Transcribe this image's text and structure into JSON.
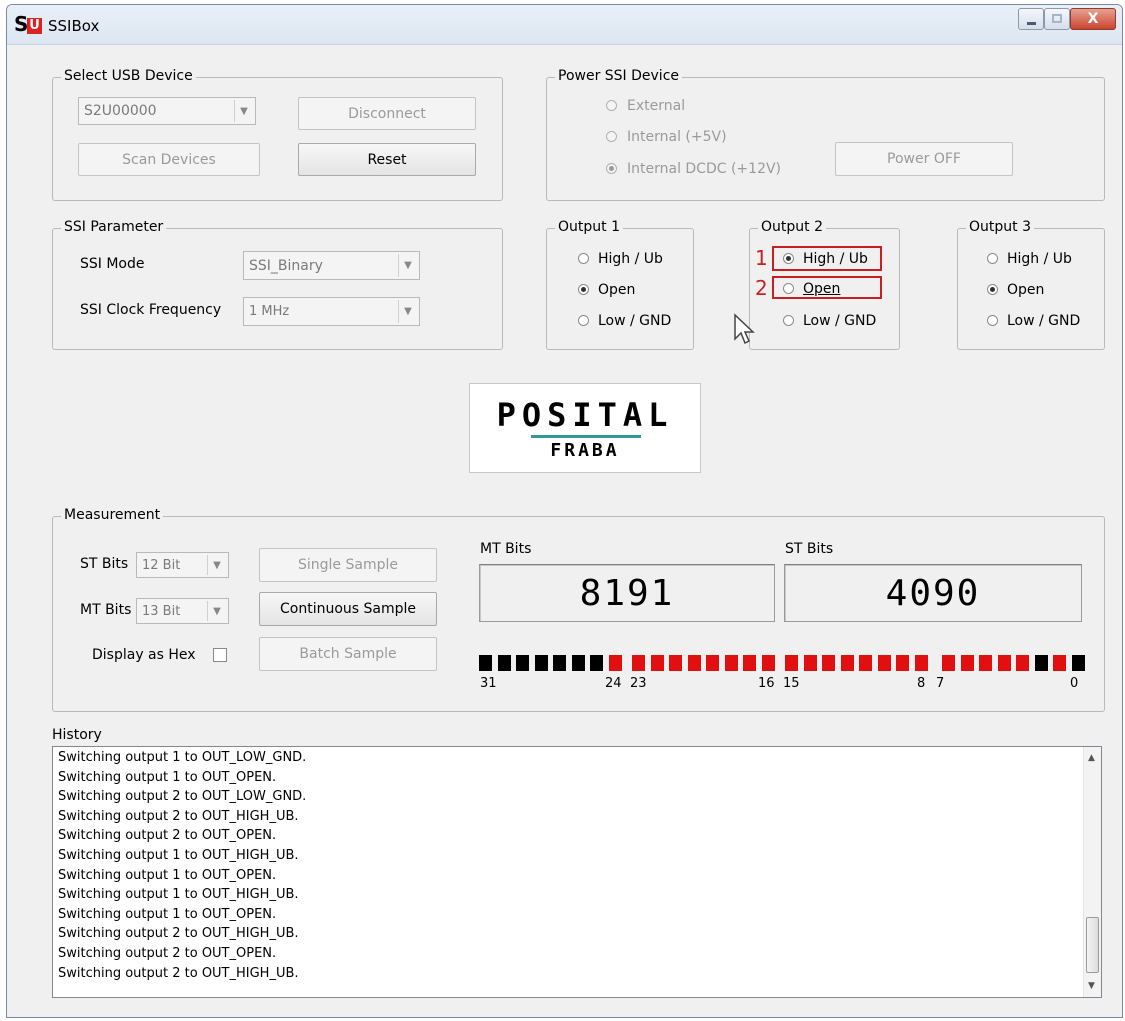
{
  "window": {
    "title": "SSIBox",
    "icon": "ssibox-app-icon",
    "icon_letters": [
      "S",
      "U"
    ],
    "close_glyph": "X"
  },
  "usb": {
    "legend": "Select USB Device",
    "device": "S2U00000",
    "disconnect": "Disconnect",
    "scan": "Scan Devices",
    "reset": "Reset"
  },
  "power": {
    "legend": "Power SSI Device",
    "options": [
      "External",
      "Internal (+5V)",
      "Internal DCDC (+12V)"
    ],
    "selected": "Internal DCDC (+12V)",
    "power_off": "Power OFF"
  },
  "ssi": {
    "legend": "SSI Parameter",
    "mode_label": "SSI Mode",
    "mode_value": "SSI_Binary",
    "clock_label": "SSI Clock Frequency",
    "clock_value": "1 MHz"
  },
  "outputs": [
    {
      "legend": "Output 1",
      "options": [
        "High / Ub",
        "Open",
        "Low / GND"
      ],
      "selected": "Open"
    },
    {
      "legend": "Output 2",
      "options": [
        "High / Ub",
        "Open",
        "Low / GND"
      ],
      "selected": "High / Ub"
    },
    {
      "legend": "Output 3",
      "options": [
        "High / Ub",
        "Open",
        "Low / GND"
      ],
      "selected": "Open"
    }
  ],
  "annotations": {
    "marker_1": "1",
    "marker_2": "2",
    "color": "#c82020"
  },
  "logo": {
    "brand": "POSITAL",
    "sub": "FRABA"
  },
  "measurement": {
    "legend": "Measurement",
    "st_label": "ST Bits",
    "st_value": "12 Bit",
    "mt_label": "MT Bits",
    "mt_value": "13 Bit",
    "hex_label": "Display as Hex",
    "hex_checked": false,
    "single": "Single Sample",
    "continuous": "Continuous Sample",
    "batch": "Batch Sample",
    "mt_display_label": "MT Bits",
    "mt_display_value": "8191",
    "st_display_label": "ST Bits",
    "st_display_value": "4090",
    "bit_labels": [
      "31",
      "24",
      "23",
      "16",
      "15",
      "8",
      "7",
      "0"
    ],
    "bits_31_to_0": [
      "black",
      "black",
      "black",
      "black",
      "black",
      "black",
      "black",
      "red",
      "red",
      "red",
      "red",
      "red",
      "red",
      "red",
      "red",
      "red",
      "red",
      "red",
      "red",
      "red",
      "red",
      "red",
      "red",
      "red",
      "red",
      "red",
      "red",
      "red",
      "red",
      "black",
      "red",
      "black"
    ],
    "bit_colors": {
      "black": "#000000",
      "red": "#e01010"
    }
  },
  "history": {
    "label": "History",
    "lines": [
      "Switching output 1 to OUT_LOW_GND.",
      "Switching output 1 to OUT_OPEN.",
      "Switching output 2 to OUT_LOW_GND.",
      "Switching output 2 to OUT_HIGH_UB.",
      "Switching output 2 to OUT_OPEN.",
      "Switching output 1 to OUT_HIGH_UB.",
      "Switching output 1 to OUT_OPEN.",
      "Switching output 1 to OUT_HIGH_UB.",
      "Switching output 1 to OUT_OPEN.",
      "Switching output 2 to OUT_HIGH_UB.",
      "Switching output 2 to OUT_OPEN.",
      "Switching output 2 to OUT_HIGH_UB."
    ]
  }
}
